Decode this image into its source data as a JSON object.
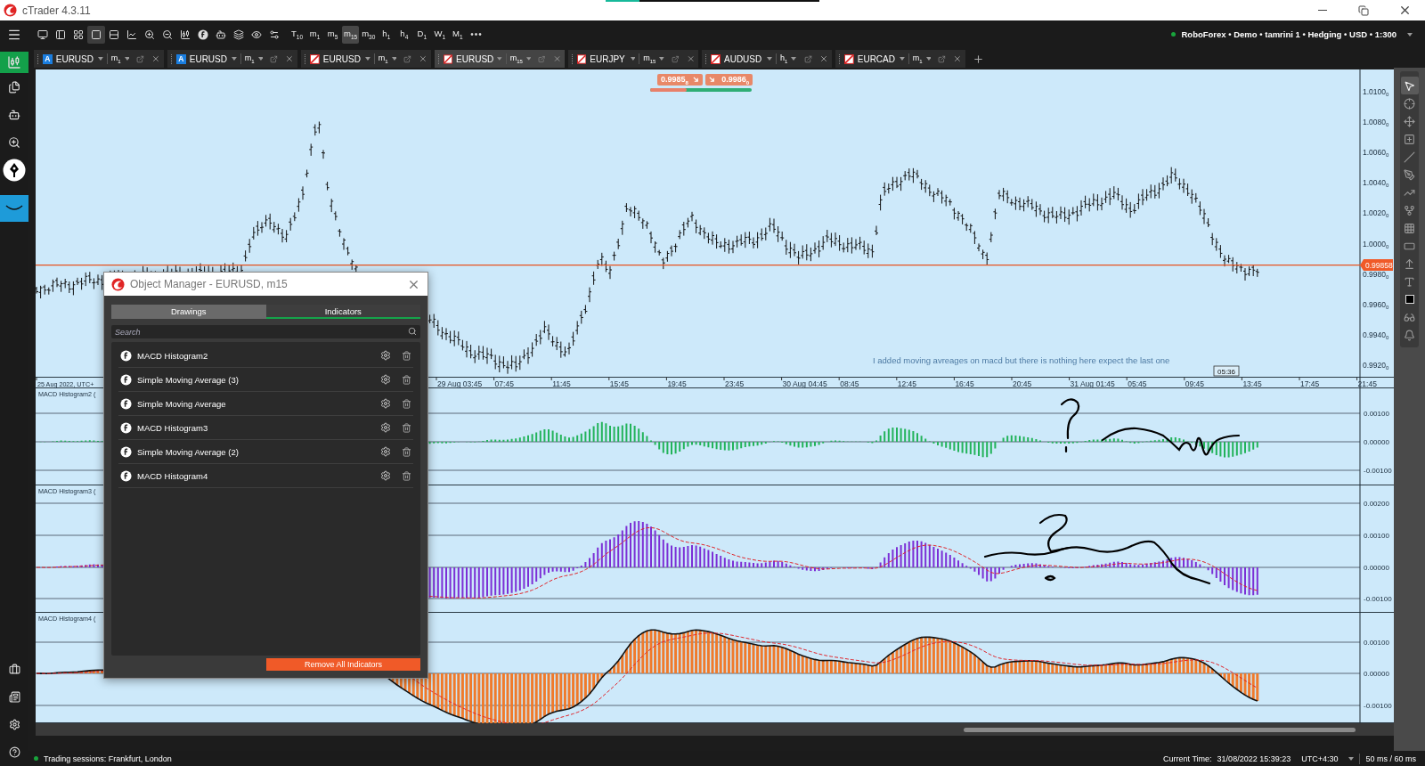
{
  "window": {
    "title": "cTrader 4.3.11"
  },
  "toolbar": {
    "timeframes": [
      {
        "unit": "T",
        "sub": "10",
        "selected": false
      },
      {
        "unit": "m",
        "sub": "1",
        "selected": false
      },
      {
        "unit": "m",
        "sub": "5",
        "selected": false
      },
      {
        "unit": "m",
        "sub": "15",
        "selected": true
      },
      {
        "unit": "m",
        "sub": "30",
        "selected": false
      },
      {
        "unit": "h",
        "sub": "1",
        "selected": false
      },
      {
        "unit": "h",
        "sub": "4",
        "selected": false
      },
      {
        "unit": "D",
        "sub": "1",
        "selected": false
      },
      {
        "unit": "W",
        "sub": "1",
        "selected": false
      },
      {
        "unit": "M",
        "sub": "1",
        "selected": false
      }
    ],
    "more": "•••",
    "account": "RoboForex • Demo • tamrini 1 • Hedging • USD • 1:300",
    "connected": true
  },
  "sidebar": [
    {
      "kind": "trade",
      "selected": true
    },
    {
      "kind": "copy",
      "selected": false
    },
    {
      "kind": "automate",
      "selected": false
    },
    {
      "kind": "analyze",
      "selected": false
    },
    {
      "kind": "pen",
      "selected": false
    },
    {
      "kind": "app",
      "selected": false
    }
  ],
  "sidebar_bottom": [
    {
      "kind": "portfolio"
    },
    {
      "kind": "news"
    },
    {
      "kind": "settings"
    },
    {
      "kind": "help"
    }
  ],
  "tabs": [
    {
      "badge": "A",
      "symbol": "EURUSD",
      "tf": {
        "unit": "m",
        "sub": "1"
      },
      "selected": false
    },
    {
      "badge": "A",
      "symbol": "EURUSD",
      "tf": {
        "unit": "m",
        "sub": "1"
      },
      "selected": false
    },
    {
      "symbol": "EURUSD",
      "tf": {
        "unit": "m",
        "sub": "1"
      },
      "selected": false
    },
    {
      "symbol": "EURUSD",
      "tf": {
        "unit": "m",
        "sub": "15"
      },
      "selected": true
    },
    {
      "symbol": "EURJPY",
      "tf": {
        "unit": "m",
        "sub": "15"
      },
      "selected": false
    },
    {
      "symbol": "AUDUSD",
      "tf": {
        "unit": "h",
        "sub": "1"
      },
      "selected": false
    },
    {
      "symbol": "EURCAD",
      "tf": {
        "unit": "m",
        "sub": "1"
      },
      "selected": false
    }
  ],
  "chart": {
    "sell": {
      "price": "0.9985",
      "sub": "8"
    },
    "buy": {
      "price": "0.9986",
      "sub": "0"
    },
    "sentiment": {
      "level": 0.36
    },
    "price_axis": [
      {
        "text": "1.0100",
        "sub": "0"
      },
      {
        "text": "1.0080",
        "sub": "0"
      },
      {
        "text": "1.0060",
        "sub": "0"
      },
      {
        "text": "1.0040",
        "sub": "0"
      },
      {
        "text": "1.0020",
        "sub": "0"
      },
      {
        "text": "1.0000",
        "sub": "0"
      },
      {
        "text": "0.9980",
        "sub": "0"
      },
      {
        "text": "0.9960",
        "sub": "0"
      },
      {
        "text": "0.9940",
        "sub": "0"
      },
      {
        "text": "0.9920",
        "sub": "0"
      }
    ],
    "current_price": "0.99858",
    "note": "I added moving avreages on macd but there is nothing here expect the last one",
    "countdown": "05:36",
    "time_axis": [
      "25 Aug 2022, UTC+",
      "29 Aug 03:45",
      "07:45",
      "11:45",
      "15:45",
      "19:45",
      "23:45",
      "30 Aug 04:45",
      "08:45",
      "12:45",
      "16:45",
      "20:45",
      "31 Aug 01:45",
      "05:45",
      "09:45",
      "13:45",
      "17:45",
      "21:45"
    ]
  },
  "panes": [
    {
      "label": "MACD Histogram2 (",
      "ticks": [
        "0.00100",
        "0.00000",
        "-0.00100"
      ],
      "color": "#22b35a",
      "signal_line": false,
      "outline": false
    },
    {
      "label": "MACD Histogram3 (",
      "ticks": [
        "0.00200",
        "0.00100",
        "0.00000",
        "-0.00100"
      ],
      "color": "#7b2fd6",
      "signal_line": true,
      "outline": false
    },
    {
      "label": "MACD Histogram4 (",
      "ticks": [
        "0.00100",
        "0.00000",
        "-0.00100"
      ],
      "color": "#f07a2a",
      "signal_line": true,
      "outline": true
    }
  ],
  "object_manager": {
    "title": "Object Manager - EURUSD, m15",
    "tabs": [
      {
        "label": "Drawings",
        "selected": false
      },
      {
        "label": "Indicators",
        "selected": true
      }
    ],
    "search": {
      "placeholder": "Search"
    },
    "items": [
      {
        "name": "MACD Histogram2"
      },
      {
        "name": "Simple Moving Average (3)"
      },
      {
        "name": "Simple Moving Average"
      },
      {
        "name": "MACD Histogram3"
      },
      {
        "name": "Simple Moving Average (2)"
      },
      {
        "name": "MACD Histogram4"
      }
    ],
    "button": "Remove All Indicators"
  },
  "drawing_tools": [
    {
      "kind": "pointer",
      "selected": true
    },
    {
      "kind": "crosshair",
      "selected": false
    },
    {
      "kind": "move",
      "selected": false
    },
    {
      "kind": "measure",
      "selected": false
    },
    {
      "kind": "line",
      "selected": false
    },
    {
      "kind": "pen",
      "selected": false
    },
    {
      "kind": "trend",
      "selected": false
    },
    {
      "kind": "fork",
      "selected": false
    },
    {
      "kind": "fibonacci",
      "selected": false
    },
    {
      "kind": "rectangle",
      "selected": false
    },
    {
      "kind": "arrow",
      "selected": false
    },
    {
      "kind": "text",
      "selected": false
    },
    {
      "kind": "color",
      "selected": false
    },
    {
      "kind": "glasses",
      "selected": false
    },
    {
      "kind": "bell",
      "selected": false
    }
  ],
  "status_bar": {
    "sessions": "Trading sessions: Frankfurt, London",
    "time_label": "Current Time:",
    "time": "31/08/2022 15:39:23",
    "timezone": "UTC+4:30",
    "latency": "50 ms / 60 ms"
  }
}
